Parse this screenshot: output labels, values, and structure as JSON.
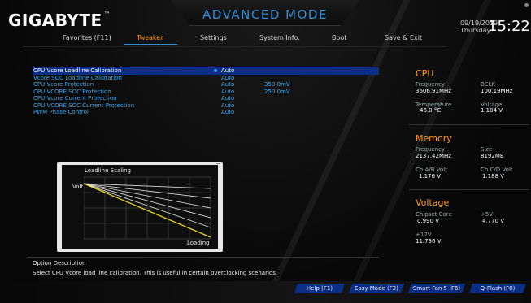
{
  "header": {
    "brand": "GIGABYTE",
    "brand_mark": "™",
    "mode_title": "ADVANCED MODE",
    "date": "09/19/2019",
    "day": "Thursday",
    "time": "15:22"
  },
  "tabs": [
    {
      "label": "Favorites (F11)"
    },
    {
      "label": "Tweaker"
    },
    {
      "label": "Settings"
    },
    {
      "label": "System Info."
    },
    {
      "label": "Boot"
    },
    {
      "label": "Save & Exit"
    }
  ],
  "active_tab": "Tweaker",
  "settings": [
    {
      "label": "CPU Vcore Loadline Calibration",
      "value": "Auto",
      "extra": "",
      "selected": true
    },
    {
      "label": "Vcore SOC Loadline Calibration",
      "value": "Auto",
      "extra": ""
    },
    {
      "label": "CPU Vcore Protection",
      "value": "Auto",
      "extra": "350.0mV"
    },
    {
      "label": "CPU VCORE SOC Protection",
      "value": "Auto",
      "extra": "250.0mV"
    },
    {
      "label": "CPU Vcore Current Protection",
      "value": "Auto",
      "extra": ""
    },
    {
      "label": "CPU VCORE SOC Current Protection",
      "value": "Auto",
      "extra": ""
    },
    {
      "label": "PWM Phase Control",
      "value": "Auto",
      "extra": ""
    }
  ],
  "loadline": {
    "title": "Loadline Scaling",
    "y_label": "Volt",
    "x_label": "Loading"
  },
  "cpu": {
    "title": "CPU",
    "frequency_label": "Frequency",
    "frequency": "3606.91MHz",
    "bclk_label": "BCLK",
    "bclk": "100.19MHz",
    "temperature_label": "Temperature",
    "temperature": "46.0 °C",
    "voltage_label": "Voltage",
    "voltage": "1.104 V"
  },
  "memory": {
    "title": "Memory",
    "frequency_label": "Frequency",
    "frequency": "2137.42MHz",
    "size_label": "Size",
    "size": "8192MB",
    "chab_label": "Ch A/B Volt",
    "chab": "1.176 V",
    "chcd_label": "Ch C/D Volt",
    "chcd": "1.188 V"
  },
  "voltage": {
    "title": "Voltage",
    "chipset_label": "Chipset Core",
    "chipset": "0.990 V",
    "p5v_label": "+5V",
    "p5v": "4.770 V",
    "p12v_label": "+12V",
    "p12v": "11.736 V"
  },
  "description": {
    "title": "Option Description",
    "text": "Select CPU Vcore load line calibration. This is useful in certain overclocking scenarios."
  },
  "footer": {
    "help": "Help (F1)",
    "easy_mode": "Easy Mode (F2)",
    "smart_fan": "Smart Fan 5 (F6)",
    "qflash": "Q-Flash (F8)"
  },
  "colors": {
    "accent_blue": "#2c8fd8",
    "highlight_orange": "#ff9c1a",
    "selection_bg": "#0b2f87",
    "curve_yellow": "#f2e21a"
  }
}
